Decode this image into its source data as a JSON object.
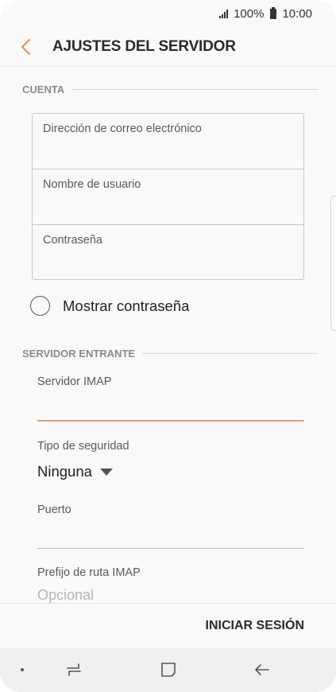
{
  "status_bar": {
    "battery_percent": "100%",
    "time": "10:00",
    "icons": [
      "signal-icon",
      "battery-icon"
    ]
  },
  "header": {
    "title": "AJUSTES DEL SERVIDOR",
    "back_icon": "chevron-left-icon",
    "accent_color": "#e8905a"
  },
  "account": {
    "section_label": "CUENTA",
    "fields": [
      {
        "placeholder": "Dirección de correo electrónico",
        "value": ""
      },
      {
        "placeholder": "Nombre de usuario",
        "value": ""
      },
      {
        "placeholder": "Contraseña",
        "value": ""
      }
    ],
    "show_password_label": "Mostrar contraseña",
    "show_password_checked": false
  },
  "incoming": {
    "section_label": "SERVIDOR ENTRANTE",
    "imap_server_label": "Servidor IMAP",
    "imap_server_value": "",
    "security_label": "Tipo de seguridad",
    "security_value": "Ninguna",
    "port_label": "Puerto",
    "port_value": "",
    "prefix_label": "Prefijo de ruta IMAP",
    "prefix_placeholder": "Opcional"
  },
  "footer": {
    "login_button": "INICIAR SESIÓN"
  },
  "nav_bar": {
    "icons": [
      "recent-apps-icon",
      "home-icon",
      "back-arrow-icon"
    ]
  }
}
